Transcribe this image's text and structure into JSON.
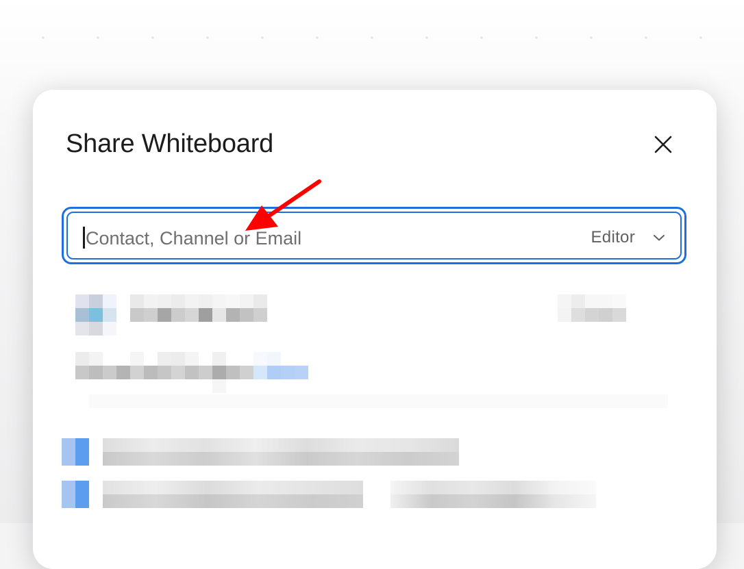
{
  "dialog": {
    "title": "Share Whiteboard",
    "close_icon": "close-icon"
  },
  "share_input": {
    "placeholder": "Contact, Channel or Email",
    "value": ""
  },
  "role_select": {
    "selected": "Editor",
    "icon": "chevron-down-icon"
  },
  "annotation": {
    "type": "arrow",
    "color": "#ff0000"
  },
  "colors": {
    "accent": "#1d6fe0",
    "title": "#1d1c1d"
  }
}
